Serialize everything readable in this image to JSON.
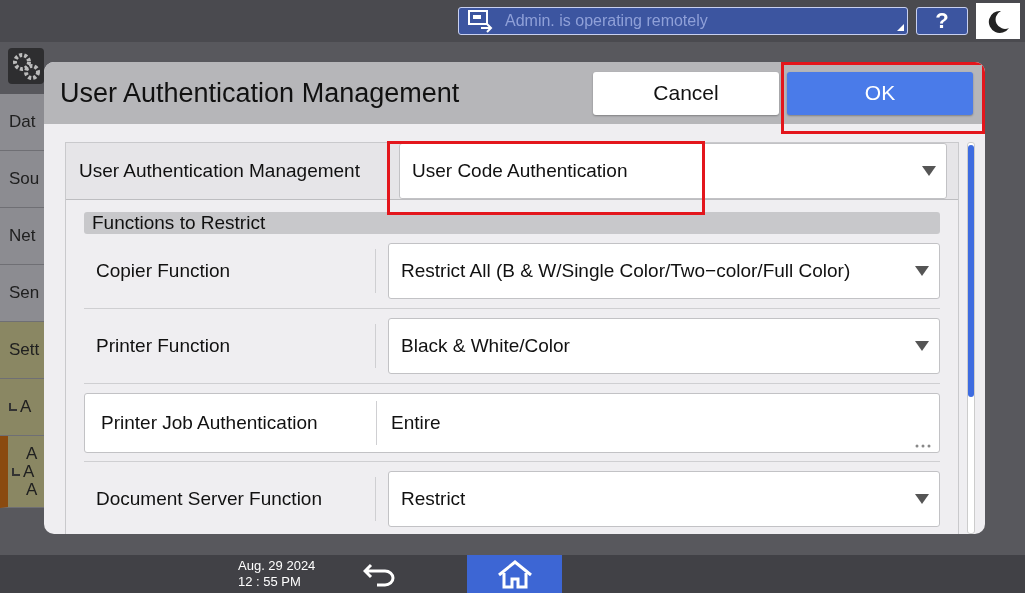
{
  "top_bar": {
    "remote_notice": "Admin. is operating remotely",
    "help_label": "?"
  },
  "background": {
    "sidebar_items": [
      {
        "lines": [
          "Dat"
        ],
        "selected": false
      },
      {
        "lines": [
          "Sou"
        ],
        "selected": false
      },
      {
        "lines": [
          "Net"
        ],
        "selected": false
      },
      {
        "lines": [
          "Sen"
        ],
        "selected": false
      },
      {
        "lines": [
          "Sett"
        ],
        "selected": true
      },
      {
        "lines": [
          "A"
        ],
        "selected": true,
        "sub": true
      },
      {
        "lines": [
          "A",
          "A",
          "A"
        ],
        "selected": true,
        "sub": true,
        "current": true
      }
    ]
  },
  "dialog": {
    "title": "User Authentication Management",
    "buttons": [
      {
        "label": "Cancel",
        "kind": "secondary"
      },
      {
        "label": "OK",
        "kind": "primary",
        "highlighted": true
      }
    ],
    "main_setting": {
      "label": "User Authentication Management",
      "value": "User Code Authentication",
      "highlighted": true
    },
    "section": "Functions to Restrict",
    "rows": [
      {
        "kind": "select",
        "label": "Copier Function",
        "value": "Restrict All (B & W/Single Color/Two−color/Full Color)"
      },
      {
        "kind": "select",
        "label": "Printer Function",
        "value": "Black & White/Color"
      },
      {
        "kind": "info",
        "label": "Printer Job Authentication",
        "value": "Entire"
      },
      {
        "kind": "select",
        "label": "Document Server Function",
        "value": "Restrict"
      }
    ]
  },
  "bottom_bar": {
    "date": "Aug. 29 2024",
    "time": "12 : 55 PM"
  }
}
